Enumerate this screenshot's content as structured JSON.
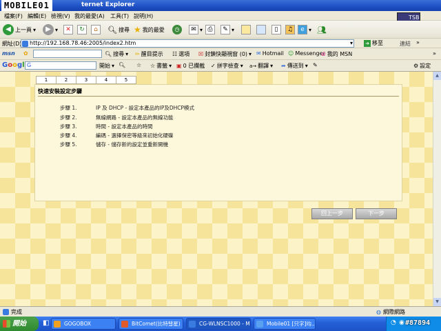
{
  "window": {
    "logo_text": "MOBILE01",
    "title": "ternet Explorer"
  },
  "menu": {
    "items": [
      "檔案(F)",
      "編輯(E)",
      "檢視(V)",
      "我的最愛(A)",
      "工具(T)",
      "說明(H)"
    ]
  },
  "brand": {
    "text": "TSB"
  },
  "toolbar": {
    "back": "上一頁",
    "search": "搜尋",
    "favorites": "我的最愛"
  },
  "address": {
    "label": "網址(D)",
    "url": "http://192.168.78.46:2005/index2.htm",
    "go": "移至",
    "links": "連結"
  },
  "msn": {
    "logo": "msn",
    "search": "搜尋",
    "highlight": "醒目提示",
    "options": "選項",
    "popup": "封鎖快顯視窗 (0)",
    "hotmail": "Hotmail",
    "messenger": "Messenger",
    "mymsn": "我的 MSN"
  },
  "google": {
    "logo": "Google",
    "start": "開始",
    "bookmarks": "書籤",
    "blocked": "0 已攔截",
    "spell": "拼字檢查",
    "translate": "翻譯",
    "send": "傳送到",
    "settings": "設定"
  },
  "wizard": {
    "tabs": [
      "1",
      "2",
      "3",
      "4",
      "5"
    ],
    "title": "快速安裝設定步驟",
    "steps": [
      {
        "num": "步驟 1.",
        "desc": "IP 及 DHCP - 設定本產品的IP及DHCP模式"
      },
      {
        "num": "步驟 2.",
        "desc": "無線網路 - 設定本產品的無線功能"
      },
      {
        "num": "步驟 3.",
        "desc": "時間 - 設定本產品的時間"
      },
      {
        "num": "步驟 4.",
        "desc": "編碼 - 選擇保密等級來初始化硬碟"
      },
      {
        "num": "步驟 5.",
        "desc": "儲存 - 儲存新的設定並重新開機"
      }
    ],
    "back_button": "回上一步",
    "next_button": "下一步"
  },
  "status": {
    "left": "完成",
    "right": "網際網路"
  },
  "taskbar": {
    "start": "開始",
    "tasks": [
      {
        "label": "GOGOBOX",
        "color": "#f0a020"
      },
      {
        "label": "BitComet(比特彗星)",
        "color": "#e05a2a"
      },
      {
        "label": "CG-WLNSC1000 - Mi...",
        "color": "#3a7be0"
      },
      {
        "label": "Mobile01 [只字]均...",
        "color": "#5aa0f0"
      }
    ]
  },
  "watermark": "#87894"
}
